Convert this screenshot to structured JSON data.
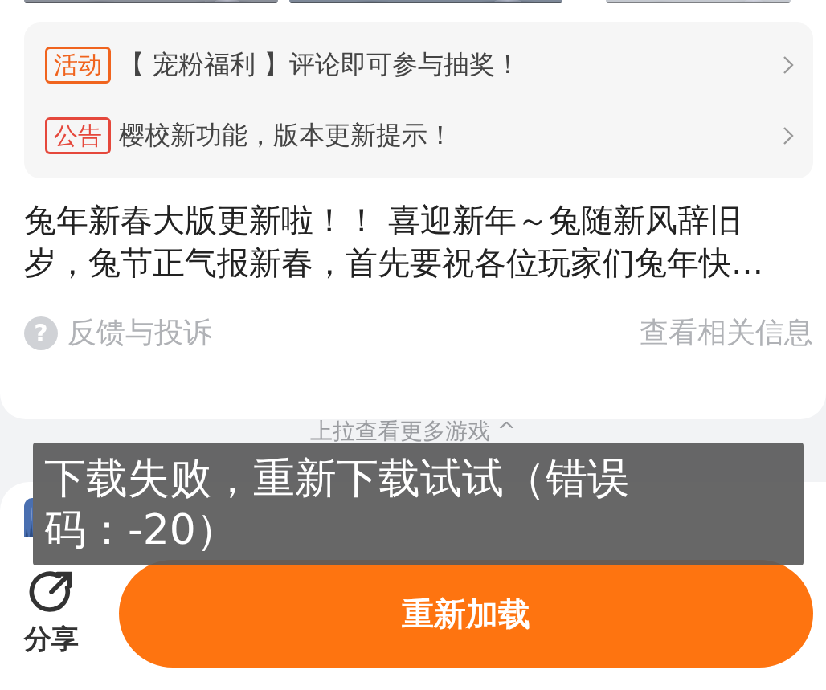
{
  "notices": [
    {
      "tag": "活动",
      "color": "#f0641e",
      "text": "【 宠粉福利 】评论即可参与抽奖！"
    },
    {
      "tag": "公告",
      "color": "#e5483c",
      "text": "樱校新功能，版本更新提示！"
    }
  ],
  "description": "兔年新春大版更新啦！！ 喜迎新年～兔随新风辞旧岁，兔节正气报新春，首先要祝各位玩家们兔年快…",
  "feedback": {
    "icon": "?",
    "label": "反馈与投诉"
  },
  "related_link": "查看相关信息",
  "pull_hint": "上拉查看更多游戏 ^",
  "toast": "下载失败，重新下载试试（错误码：-20）",
  "bottom_bar": {
    "share_label": "分享",
    "reload_button": "重新加载"
  }
}
